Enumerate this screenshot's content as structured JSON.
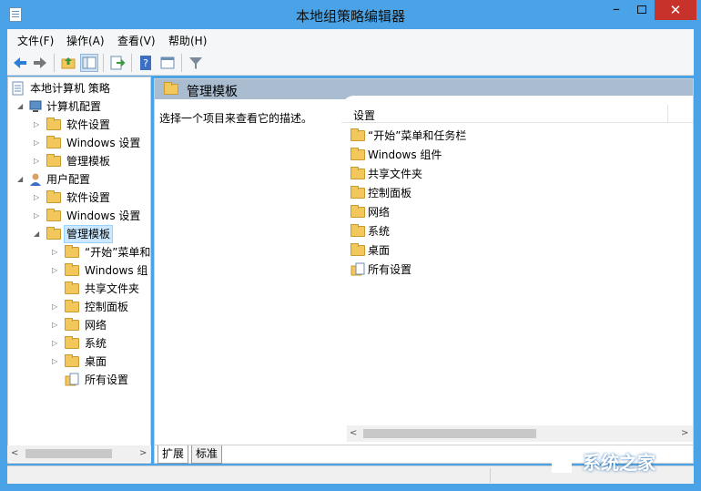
{
  "window": {
    "title": "本地组策略编辑器"
  },
  "menu": [
    "文件(F)",
    "操作(A)",
    "查看(V)",
    "帮助(H)"
  ],
  "tree": {
    "root": "本地计算机 策略",
    "computer": {
      "label": "计算机配置",
      "children": [
        "软件设置",
        "Windows 设置",
        "管理模板"
      ]
    },
    "user": {
      "label": "用户配置",
      "children": [
        "软件设置",
        "Windows 设置",
        "管理模板"
      ]
    },
    "admin_children": [
      "“开始”菜单和",
      "Windows 组",
      "共享文件夹",
      "控制面板",
      "网络",
      "系统",
      "桌面",
      "所有设置"
    ]
  },
  "right": {
    "section_title": "管理模板",
    "description": "选择一个项目来查看它的描述。",
    "column_header": "设置",
    "items": [
      "“开始”菜单和任务栏",
      "Windows 组件",
      "共享文件夹",
      "控制面板",
      "网络",
      "系统",
      "桌面",
      "所有设置"
    ]
  },
  "tabs": [
    "扩展",
    "标准"
  ],
  "watermark": "系统之家"
}
